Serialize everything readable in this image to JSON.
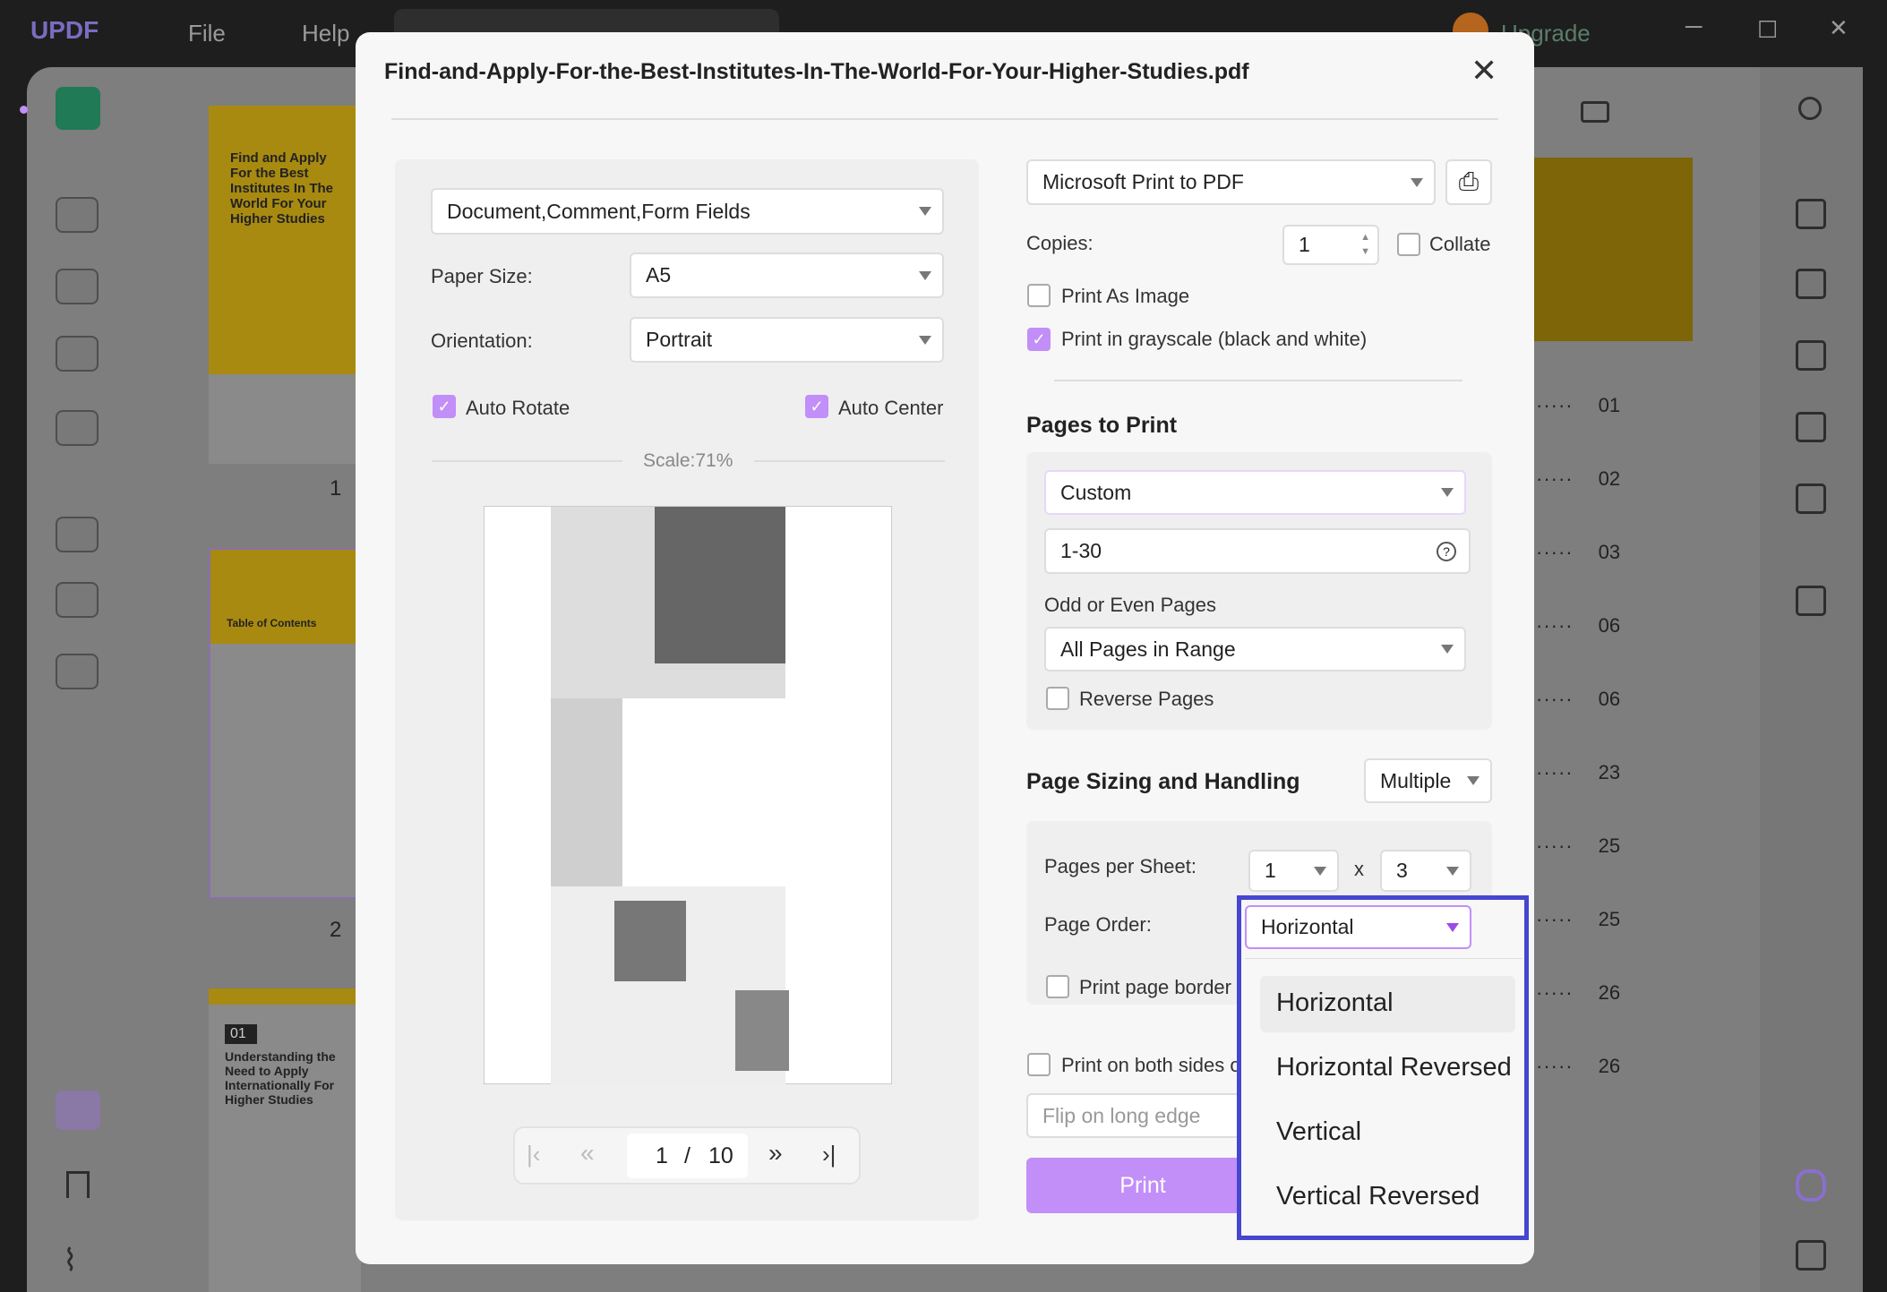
{
  "titlebar": {
    "logo": "UPDF",
    "menu": [
      "File",
      "Help"
    ],
    "upgrade": "Upgrade"
  },
  "thumbnails": {
    "page_numbers": [
      "1",
      "2"
    ],
    "p1_title": "Find and Apply For the Best Institutes In The World For Your Higher Studies",
    "p2_title": "Table of Contents",
    "p3_num": "01",
    "p3_title": "Understanding the Need to Apply Internationally For Higher Studies"
  },
  "toc_numbers": [
    "01",
    "02",
    "03",
    "06",
    "06",
    "23",
    "25",
    "25",
    "26",
    "26"
  ],
  "dialog": {
    "title": "Find-and-Apply-For-the-Best-Institutes-In-The-World-For-Your-Higher-Studies.pdf",
    "content_select": "Document,Comment,Form Fields",
    "paper_size_label": "Paper Size:",
    "paper_size": "A5",
    "orientation_label": "Orientation:",
    "orientation": "Portrait",
    "auto_rotate": "Auto Rotate",
    "auto_center": "Auto Center",
    "scale": "Scale:71%",
    "pager": {
      "current": "1",
      "sep": "/",
      "total": "10"
    },
    "printer": "Microsoft Print to PDF",
    "copies_label": "Copies:",
    "copies": "1",
    "collate": "Collate",
    "print_as_image": "Print As Image",
    "grayscale": "Print in grayscale (black and white)",
    "pages_heading": "Pages to Print",
    "pages_mode": "Custom",
    "range": "1-30",
    "odd_even_label": "Odd or Even Pages",
    "odd_even": "All Pages in Range",
    "reverse": "Reverse Pages",
    "sizing_heading": "Page Sizing and Handling",
    "sizing_mode": "Multiple",
    "pps_label": "Pages per Sheet:",
    "pps_cols": "1",
    "pps_x": "x",
    "pps_rows": "3",
    "order_label": "Page Order:",
    "order": "Horizontal",
    "order_options": [
      "Horizontal",
      "Horizontal Reversed",
      "Vertical",
      "Vertical Reversed"
    ],
    "page_border": "Print page border",
    "both_sides": "Print on both sides o",
    "flip": "Flip on long edge",
    "print_button": "Print",
    "accent": "#c28ef8",
    "highlight": "#4646d0"
  }
}
